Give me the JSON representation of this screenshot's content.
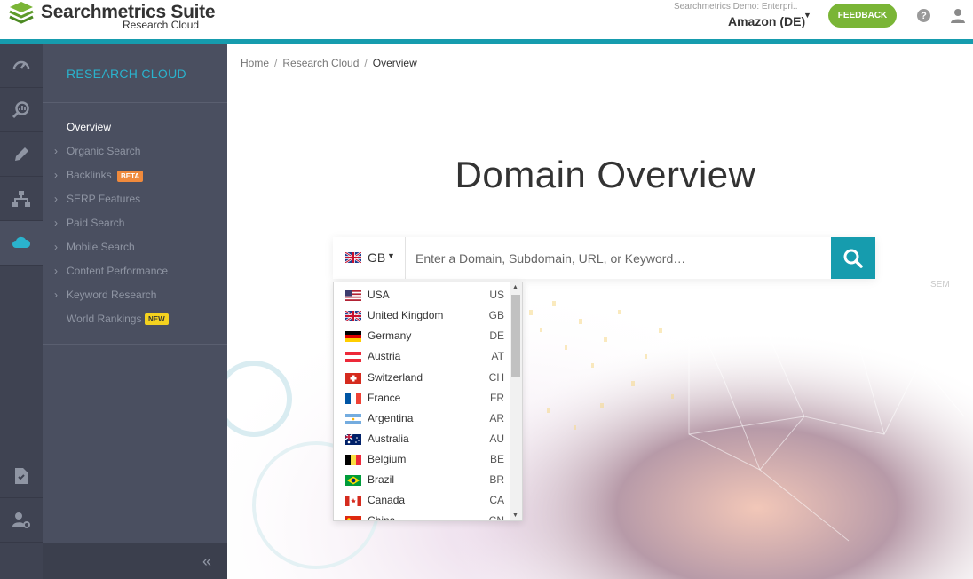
{
  "app": {
    "brand": "Searchmetrics Suite",
    "brand_sub": "Research Cloud",
    "logo_icon": "searchmetrics-stack-logo"
  },
  "header": {
    "account_caption": "Searchmetrics Demo: Enterpri...",
    "account_name": "Amazon (DE)",
    "feedback_label": "FEEDBACK",
    "help_label": "?",
    "colors": {
      "accent": "#169cae",
      "feedback": "#7ab536"
    }
  },
  "rail": {
    "items": [
      {
        "icon": "speedometer-icon"
      },
      {
        "icon": "magnifier-chart-icon"
      },
      {
        "icon": "pencil-icon"
      },
      {
        "icon": "sitemap-icon"
      },
      {
        "icon": "cloud-icon",
        "active": true
      },
      {
        "icon": "document-icon"
      },
      {
        "icon": "user-settings-icon"
      }
    ]
  },
  "sidebar": {
    "title": "RESEARCH CLOUD",
    "items": [
      {
        "label": "Overview",
        "active": true
      },
      {
        "label": "Organic Search"
      },
      {
        "label": "Backlinks",
        "badge": "BETA"
      },
      {
        "label": "SERP Features"
      },
      {
        "label": "Paid Search"
      },
      {
        "label": "Mobile Search"
      },
      {
        "label": "Content Performance"
      },
      {
        "label": "Keyword Research"
      },
      {
        "label": "World Rankings",
        "badge": "NEW"
      }
    ],
    "collapse_label": "«"
  },
  "breadcrumb": {
    "items": [
      "Home",
      "Research Cloud"
    ],
    "current": "Overview"
  },
  "main": {
    "title": "Domain Overview",
    "watermark": "SEM"
  },
  "search": {
    "country_code": "GB",
    "placeholder": "Enter a Domain, Subdomain, URL, or Keyword…",
    "value": ""
  },
  "countries": [
    {
      "name": "USA",
      "code": "US"
    },
    {
      "name": "United Kingdom",
      "code": "GB"
    },
    {
      "name": "Germany",
      "code": "DE"
    },
    {
      "name": "Austria",
      "code": "AT"
    },
    {
      "name": "Switzerland",
      "code": "CH"
    },
    {
      "name": "France",
      "code": "FR"
    },
    {
      "name": "Argentina",
      "code": "AR"
    },
    {
      "name": "Australia",
      "code": "AU"
    },
    {
      "name": "Belgium",
      "code": "BE"
    },
    {
      "name": "Brazil",
      "code": "BR"
    },
    {
      "name": "Canada",
      "code": "CA"
    },
    {
      "name": "China",
      "code": "CN"
    }
  ]
}
